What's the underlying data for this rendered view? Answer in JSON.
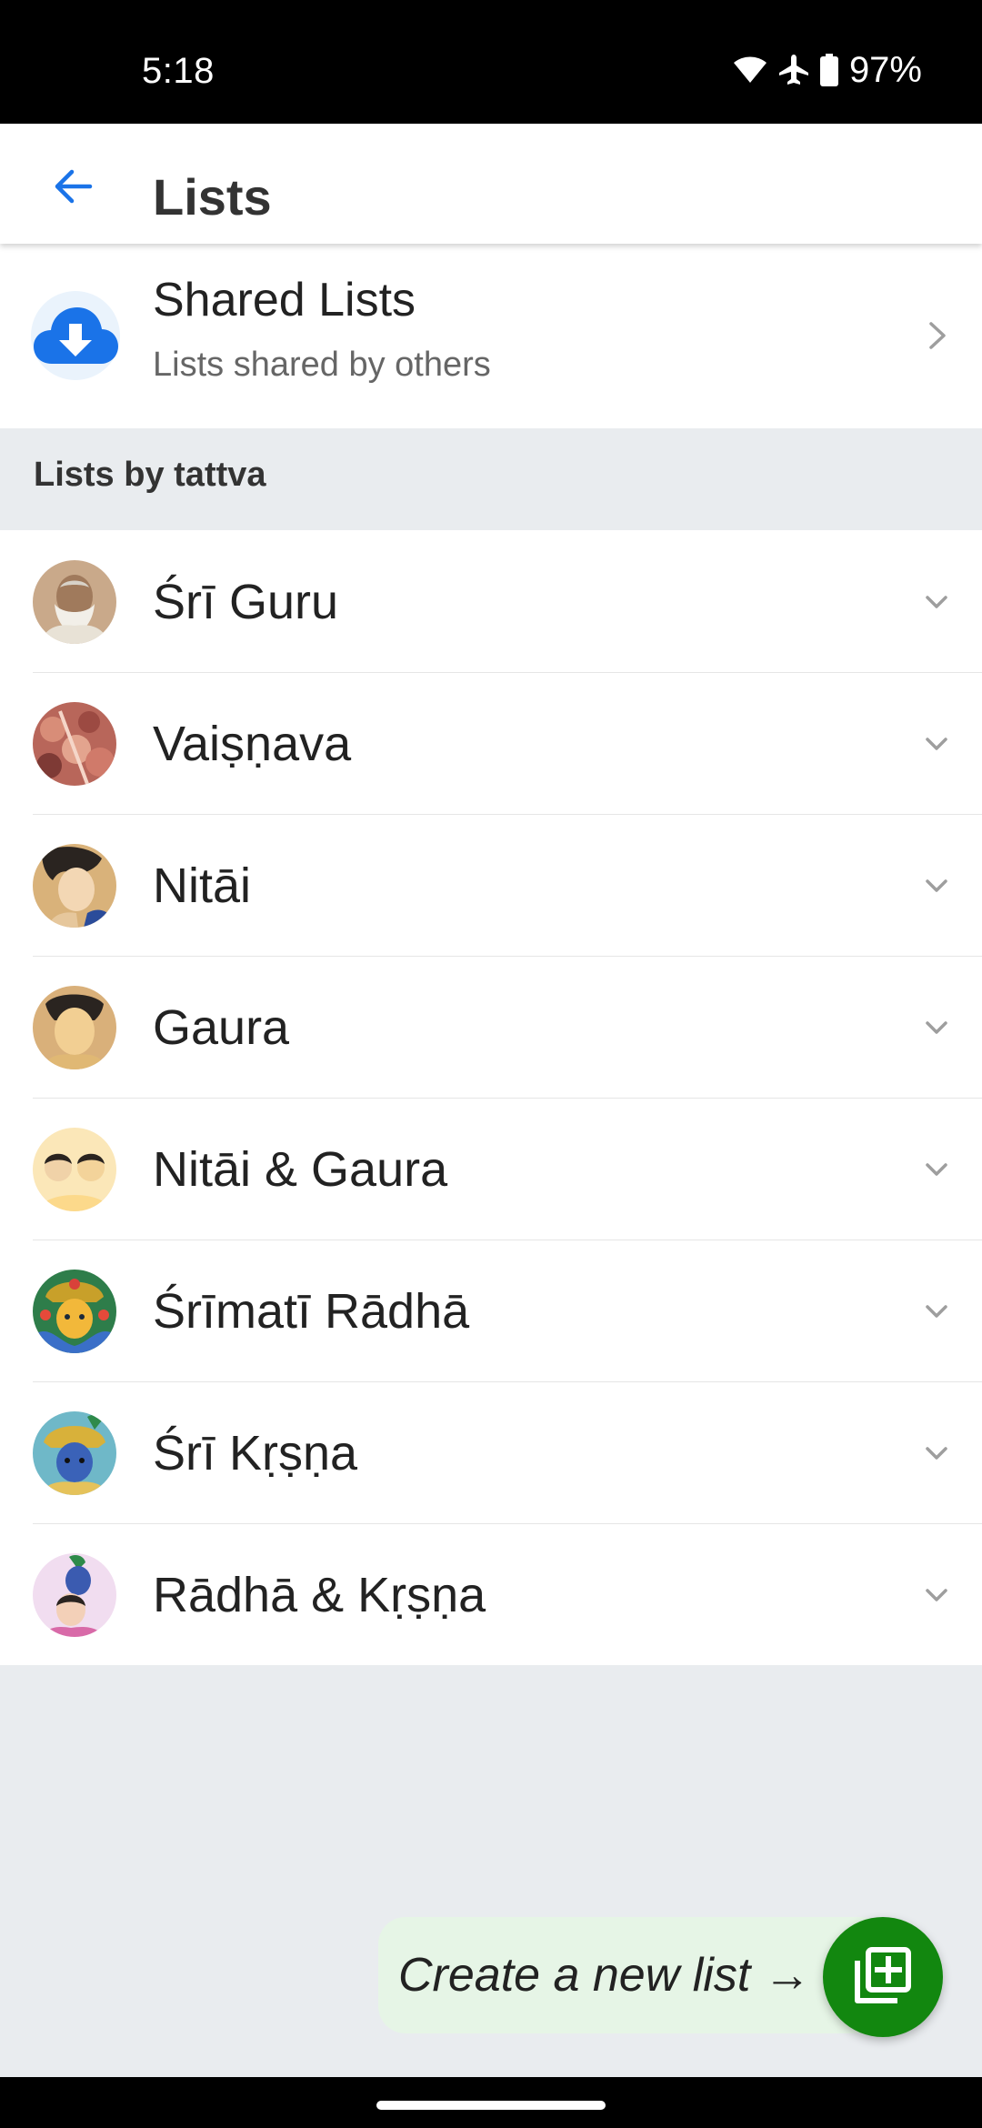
{
  "status_bar": {
    "time": "5:18",
    "battery": "97%",
    "icons": [
      "wifi-icon",
      "airplane-icon",
      "battery-icon"
    ]
  },
  "app_bar": {
    "title": "Lists",
    "back_icon": "arrow-left-icon"
  },
  "shared_lists": {
    "title": "Shared Lists",
    "subtitle": "Lists shared by others",
    "icon": "cloud-download-icon"
  },
  "section": {
    "title": "Lists by tattva"
  },
  "tattva_items": [
    {
      "label": "Śrī Guru",
      "avatar": "guru-portrait"
    },
    {
      "label": "Vaiṣṇava",
      "avatar": "vaishnava-image"
    },
    {
      "label": "Nitāi",
      "avatar": "nitai-portrait"
    },
    {
      "label": "Gaura",
      "avatar": "gaura-portrait"
    },
    {
      "label": "Nitāi & Gaura",
      "avatar": "nitai-gaura-portrait"
    },
    {
      "label": "Śrīmatī Rādhā",
      "avatar": "radha-portrait"
    },
    {
      "label": "Śrī Kṛṣṇa",
      "avatar": "krishna-portrait"
    },
    {
      "label": "Rādhā & Kṛṣṇa",
      "avatar": "radha-krishna-portrait"
    }
  ],
  "fab": {
    "hint": "Create a new list →",
    "icon": "add-list-icon"
  },
  "colors": {
    "accent": "#1a73e8",
    "fab": "#12870f",
    "hint_bg": "#e6f5e6",
    "section_bg": "#e9ecef"
  }
}
